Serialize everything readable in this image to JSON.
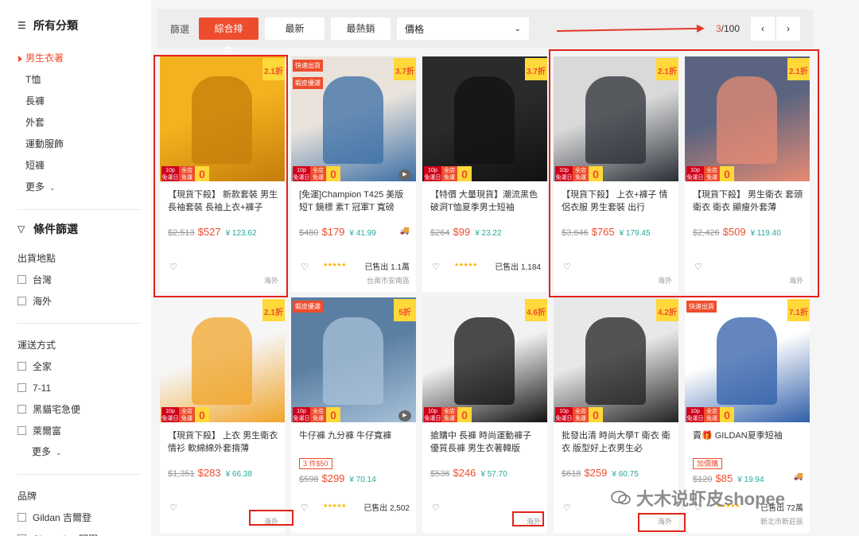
{
  "sidebar": {
    "categories_title": "所有分類",
    "categories": [
      {
        "label": "男生衣著",
        "active": true
      },
      {
        "label": "T恤",
        "active": false
      },
      {
        "label": "長褲",
        "active": false
      },
      {
        "label": "外套",
        "active": false
      },
      {
        "label": "運動服飾",
        "active": false
      },
      {
        "label": "短褲",
        "active": false
      }
    ],
    "more_label": "更多",
    "filter_title": "條件篩選",
    "ship_from_title": "出貨地點",
    "ship_from": [
      "台灣",
      "海外"
    ],
    "shipping_title": "運送方式",
    "shipping": [
      "全家",
      "7-11",
      "黑貓宅急便",
      "萊爾富"
    ],
    "shipping_more": "更多",
    "brand_title": "品牌",
    "brands": [
      "Gildan 吉爾登",
      "Champion 冠軍"
    ]
  },
  "topbar": {
    "filter_label": "篩選",
    "sort_options": [
      {
        "label": "綜合排名",
        "active": true
      },
      {
        "label": "最新",
        "active": false
      },
      {
        "label": "最熱銷",
        "active": false
      }
    ],
    "price_label": "價格",
    "page_current": "3",
    "page_total": "/100"
  },
  "products": [
    {
      "title": "【現貨下殺】 新款套裝 男生長袖套裝 長袖上衣+褲子",
      "discount": "2.1折",
      "old_price": "$2,513",
      "price": "$527",
      "cashback": "¥ 123.62",
      "sold": "",
      "location": "海外",
      "tag": "",
      "tag2": "",
      "badge": "",
      "video": false,
      "truck": false,
      "stars": false
    },
    {
      "title": "[免運]Champion T425 美版短T 鏡標 素T 冠軍T 寬磅",
      "discount": "3.7折",
      "old_price": "$480",
      "price": "$179",
      "cashback": "¥ 41.99",
      "sold": "已售出 1.1萬",
      "location": "台南市安南區",
      "tag": "快速出貨",
      "tag2": "蝦皮優選",
      "badge": "",
      "video": true,
      "truck": true,
      "stars": true
    },
    {
      "title": "【特價 大量現貨】潮流黑色破洞T恤夏季男士短袖",
      "discount": "3.7折",
      "old_price": "$264",
      "price": "$99",
      "cashback": "¥ 23.22",
      "sold": "已售出 1,184",
      "location": "",
      "tag": "",
      "tag2": "",
      "badge": "",
      "video": false,
      "truck": false,
      "stars": true
    },
    {
      "title": "【現貨下殺】 上衣+褲子 情侶衣服 男生套裝 出行",
      "discount": "2.1折",
      "old_price": "$3,646",
      "price": "$765",
      "cashback": "¥ 179.45",
      "sold": "",
      "location": "海外",
      "tag": "",
      "tag2": "",
      "badge": "",
      "video": false,
      "truck": false,
      "stars": false
    },
    {
      "title": "【現貨下殺】 男生衛衣 套頭衛衣 衛衣 顯瘦外套薄",
      "discount": "2.1折",
      "old_price": "$2,426",
      "price": "$509",
      "cashback": "¥ 119.40",
      "sold": "",
      "location": "海外",
      "tag": "",
      "tag2": "",
      "badge": "",
      "video": false,
      "truck": false,
      "stars": false
    },
    {
      "title": "【現貨下殺】 上衣 男生衛衣 情衫 軟綿綿外套揹薄",
      "discount": "2.1折",
      "old_price": "$1,351",
      "price": "$283",
      "cashback": "¥ 66.38",
      "sold": "",
      "location": "海外",
      "tag": "",
      "tag2": "",
      "badge": "",
      "video": false,
      "truck": false,
      "stars": false
    },
    {
      "title": "牛仔褲 九分褲 牛仔寬褲",
      "discount": "5折",
      "old_price": "$598",
      "price": "$299",
      "cashback": "¥ 70.14",
      "sold": "已售出 2,502",
      "location": "",
      "tag": "蝦皮優選",
      "tag2": "",
      "badge": "3 件$50",
      "video": true,
      "truck": false,
      "stars": true
    },
    {
      "title": "搶購中 長褲 時尚運動褲子 優質長褲 男生衣著韓版",
      "discount": "4.6折",
      "old_price": "$536",
      "price": "$246",
      "cashback": "¥ 57.70",
      "sold": "",
      "location": "海外",
      "tag": "",
      "tag2": "",
      "badge": "",
      "video": false,
      "truck": false,
      "stars": false
    },
    {
      "title": "批發出清 時尚大學T 衛衣 衛衣 版型好上衣男生必",
      "discount": "4.2折",
      "old_price": "$618",
      "price": "$259",
      "cashback": "¥ 60.75",
      "sold": "",
      "location": "海外",
      "tag": "",
      "tag2": "",
      "badge": "",
      "video": false,
      "truck": false,
      "stars": false
    },
    {
      "title": "賣🎁 GILDAN夏季短袖",
      "discount": "7.1折",
      "old_price": "$120",
      "price": "$85",
      "cashback": "¥ 19.94",
      "sold": "已售出 72萬",
      "location": "新北市新莊區",
      "tag": "快速出貨",
      "tag2": "",
      "badge": "加價購",
      "video": false,
      "truck": true,
      "stars": true
    }
  ],
  "promo": {
    "line1": "10p",
    "line1b": "免運日",
    "line2": "全店",
    "line2b": "免運",
    "big": "0"
  },
  "watermark": "大木说虾皮shopee",
  "colors": {
    "accent": "#ee4d2d",
    "annotation": "#e2231a",
    "cashback": "#26aa99"
  }
}
